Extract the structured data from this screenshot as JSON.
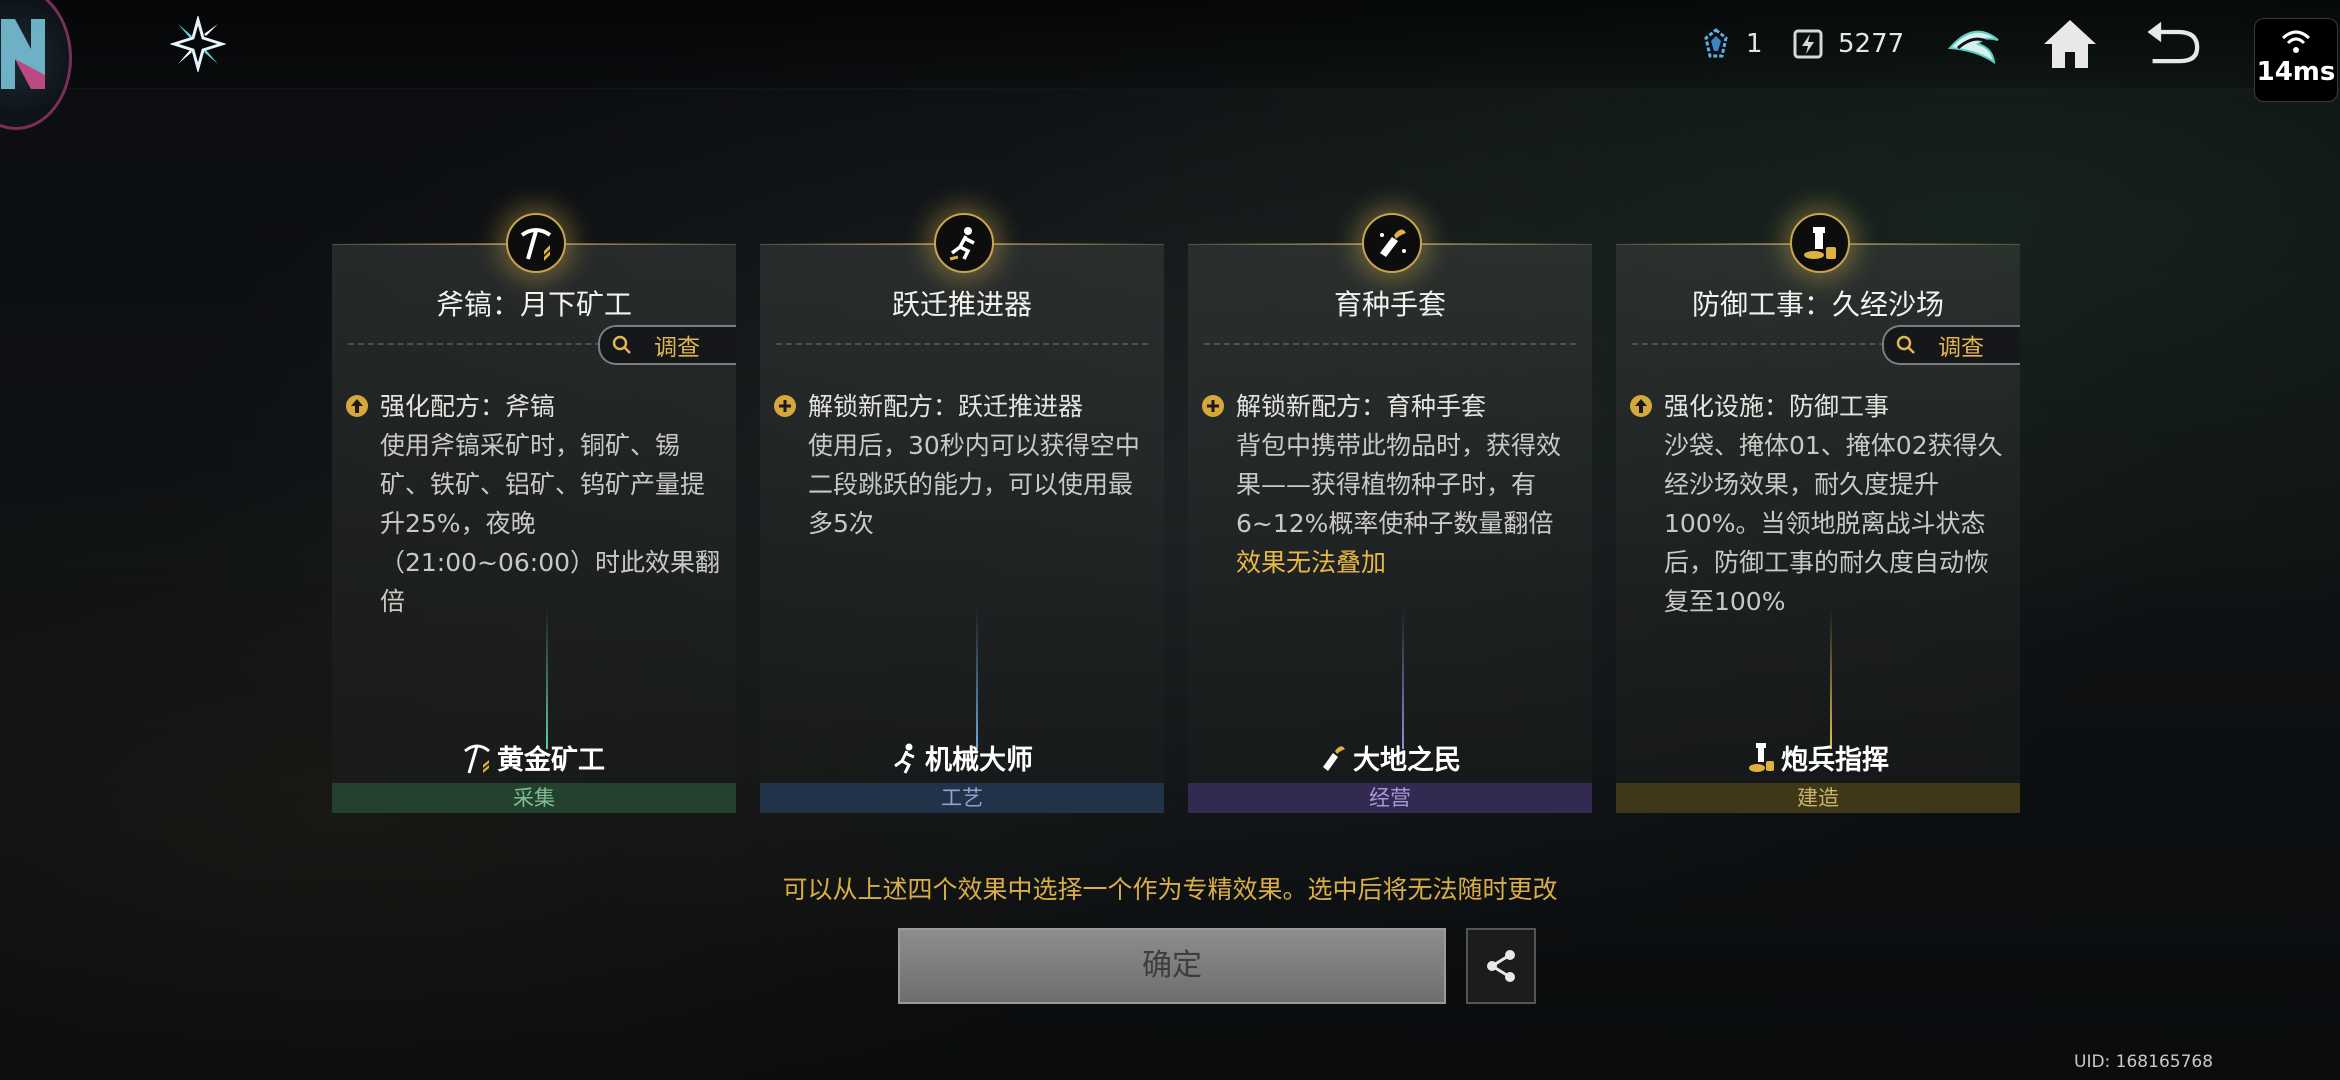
{
  "topbar": {
    "resource_1": "1",
    "resource_2": "5277",
    "ping": "14ms"
  },
  "cards": [
    {
      "title": "斧镐：月下矿工",
      "investigate": "调查",
      "heading": "强化配方：斧镐",
      "body": "使用斧镐采矿时，铜矿、锡矿、铁矿、铝矿、钨矿产量提升25%，夜晚（21:00~06:00）时此效果翻倍",
      "warning": "",
      "mastery": "黄金矿工",
      "category": "采集",
      "category_color": "#2f5a3f",
      "category_text_color": "#7fbf8f",
      "beam_color": "#5fd0a0"
    },
    {
      "title": "跃迁推进器",
      "investigate": "",
      "heading": "解锁新配方：跃迁推进器",
      "body": "使用后，30秒内可以获得空中二段跳跃的能力，可以使用最多5次",
      "warning": "",
      "mastery": "机械大师",
      "category": "工艺",
      "category_color": "#2c3c55",
      "category_text_color": "#8aa6d0",
      "beam_color": "#6aa8e0"
    },
    {
      "title": "育种手套",
      "investigate": "",
      "heading": "解锁新配方：育种手套",
      "body": "背包中携带此物品时，获得效果——获得植物种子时，有6~12%概率使种子数量翻倍",
      "warning": "效果无法叠加",
      "mastery": "大地之民",
      "category": "经营",
      "category_color": "#3e3460",
      "category_text_color": "#a698d8",
      "beam_color": "#9a8ae0"
    },
    {
      "title": "防御工事：久经沙场",
      "investigate": "调查",
      "heading": "强化设施：防御工事",
      "body": "沙袋、掩体01、掩体02获得久经沙场效果，耐久度提升100%。当领地脱离战斗状态后，防御工事的耐久度自动恢复至100%",
      "warning": "",
      "mastery": "炮兵指挥",
      "category": "建造",
      "category_color": "#4a4220",
      "category_text_color": "#c9b468",
      "beam_color": "#e0c050"
    }
  ],
  "hint": "可以从上述四个效果中选择一个作为专精效果。选中后将无法随时更改",
  "confirm_label": "确定",
  "uid": "UID: 168165768",
  "colors": {
    "accent_gold": "#e1b64f",
    "title_white": "#f2f2ee"
  }
}
